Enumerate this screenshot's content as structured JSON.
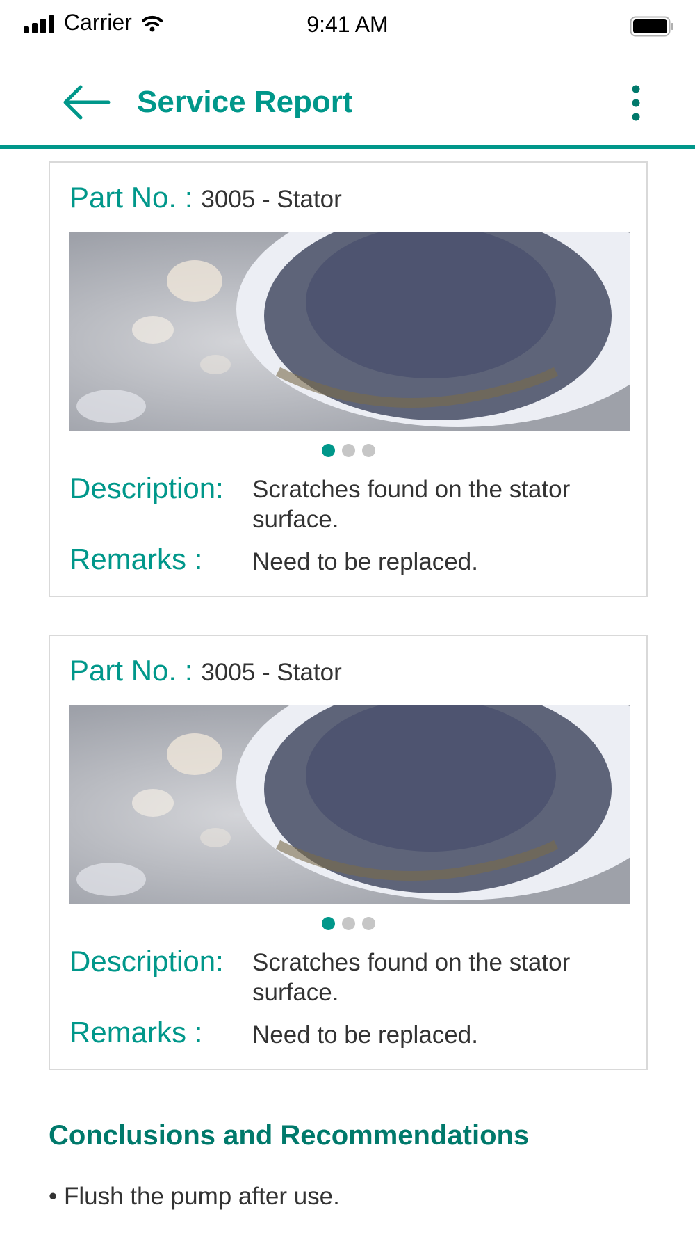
{
  "status_bar": {
    "carrier": "Carrier",
    "time": "9:41 AM",
    "icons": [
      "signal-icon",
      "wifi-icon",
      "battery-icon"
    ]
  },
  "header": {
    "title": "Service Report",
    "back_icon": "arrow-left-icon",
    "menu_icon": "more-vertical-icon"
  },
  "colors": {
    "accent": "#00978a",
    "heading": "#00796b",
    "border": "#d9d9d9",
    "dot_inactive": "#c6c6c6"
  },
  "parts": [
    {
      "part_label": "Part No. :",
      "part_value": "3005 - Stator",
      "carousel_total": 3,
      "carousel_active": 1,
      "description_label": "Description:",
      "description_value": "Scratches found on the stator surface.",
      "remarks_label": "Remarks :",
      "remarks_value": "Need to be replaced."
    },
    {
      "part_label": "Part No. :",
      "part_value": "3005 - Stator",
      "carousel_total": 3,
      "carousel_active": 1,
      "description_label": "Description:",
      "description_value": "Scratches found on the stator surface.",
      "remarks_label": "Remarks :",
      "remarks_value": "Need to be replaced."
    }
  ],
  "conclusions": {
    "heading": "Conclusions and Recommendations",
    "items": [
      "• Flush the pump after use."
    ]
  }
}
